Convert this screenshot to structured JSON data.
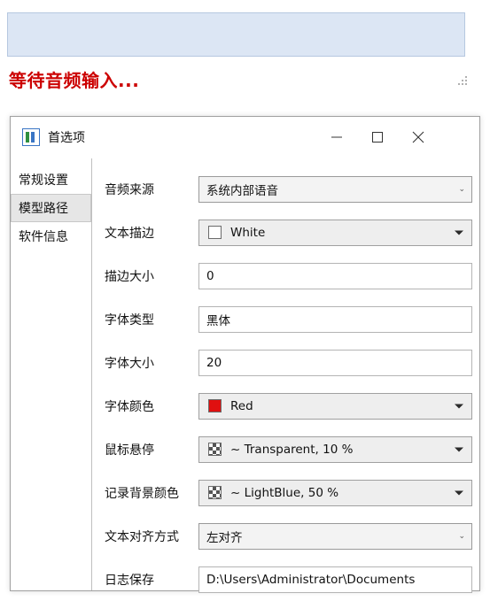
{
  "background": {
    "caption_box_placeholder": "",
    "status_text": "等待音频输入...",
    "caption_bg": "#dce6f4",
    "status_color": "#cc0000"
  },
  "dialog": {
    "title": "首选项",
    "window_buttons": {
      "minimize": "minimize-button",
      "maximize": "maximize-button",
      "close": "close-button"
    },
    "sidebar": {
      "items": [
        {
          "label": "常规设置",
          "selected": false
        },
        {
          "label": "模型路径",
          "selected": true
        },
        {
          "label": "软件信息",
          "selected": false
        }
      ]
    },
    "fields": [
      {
        "label": "音频来源",
        "value": "系统内部语音",
        "type": "combo-thin"
      },
      {
        "label": "文本描边",
        "value": "White",
        "type": "combo-color",
        "swatch": "#ffffff"
      },
      {
        "label": "描边大小",
        "value": "0",
        "type": "text"
      },
      {
        "label": "字体类型",
        "value": "黑体",
        "type": "text"
      },
      {
        "label": "字体大小",
        "value": "20",
        "type": "text"
      },
      {
        "label": "字体颜色",
        "value": "Red",
        "type": "combo-color",
        "swatch": "#e01010"
      },
      {
        "label": "鼠标悬停",
        "value": "~ Transparent, 10 %",
        "type": "combo-checker"
      },
      {
        "label": "记录背景颜色",
        "value": "~ LightBlue, 50 %",
        "type": "combo-checker"
      },
      {
        "label": "文本对齐方式",
        "value": "左对齐",
        "type": "combo-thin"
      },
      {
        "label": "日志保存",
        "value": "D:\\Users\\Administrator\\Documents",
        "type": "text"
      }
    ]
  }
}
